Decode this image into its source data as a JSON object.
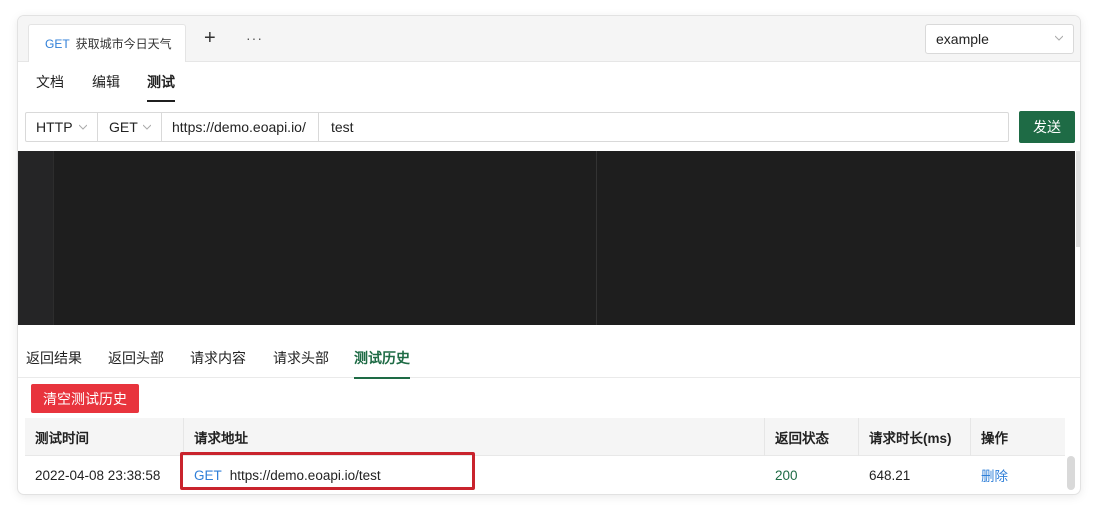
{
  "tabbar": {
    "tab": {
      "method": "GET",
      "title": "获取城市今日天气"
    },
    "add_label": "+",
    "more_label": "···",
    "env_select_value": "example"
  },
  "subnav": {
    "items": [
      "文档",
      "编辑",
      "测试"
    ],
    "active": "测试"
  },
  "request": {
    "protocol": "HTTP",
    "method": "GET",
    "url_prefix": "https://demo.eoapi.io/",
    "path": "test",
    "send_label": "发送"
  },
  "response_tabs": {
    "items": [
      "返回结果",
      "返回头部",
      "请求内容",
      "请求头部",
      "测试历史"
    ],
    "active": "测试历史"
  },
  "history": {
    "clear_label": "清空测试历史",
    "columns": [
      "测试时间",
      "请求地址",
      "返回状态",
      "请求时长(ms)",
      "操作"
    ],
    "rows": [
      {
        "time": "2022-04-08 23:38:58",
        "method": "GET",
        "url": "https://demo.eoapi.io/test",
        "status": "200",
        "duration": "648.21",
        "action": "删除"
      }
    ]
  },
  "colors": {
    "accent_green": "#1e6b45",
    "danger_red": "#e8343d",
    "link_blue": "#2f7fd8",
    "highlight_red": "#c9232d"
  }
}
